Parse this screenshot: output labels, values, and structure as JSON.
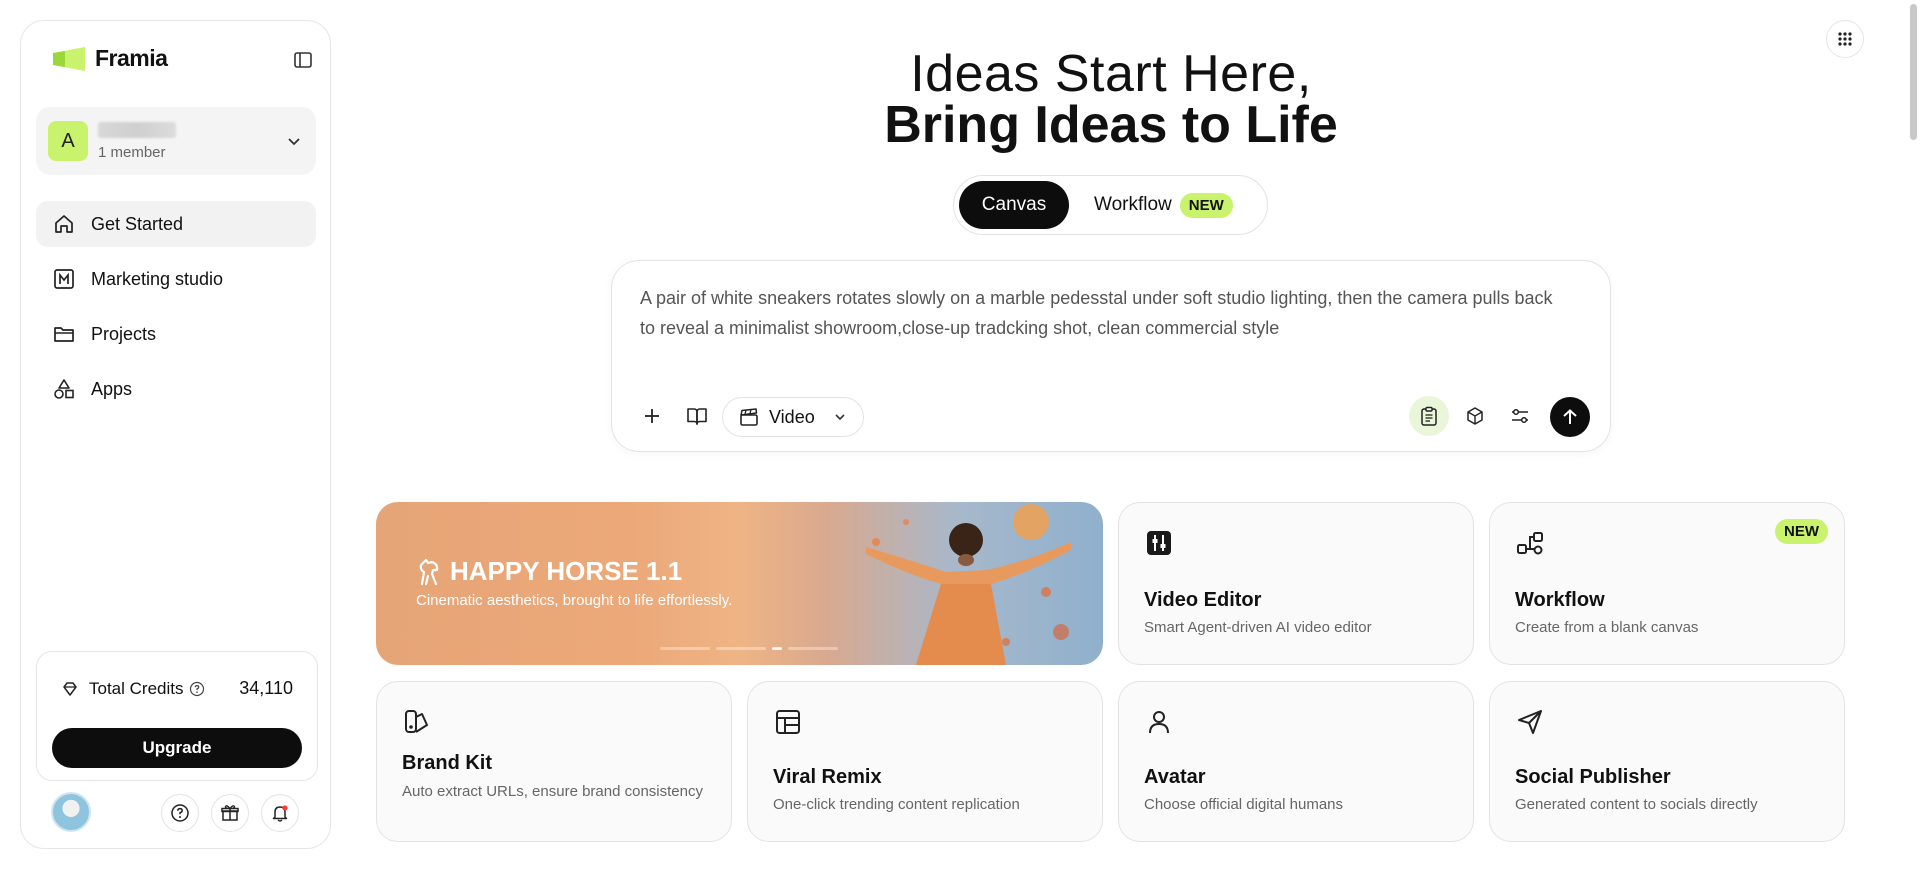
{
  "brand": {
    "name": "Framia",
    "accent": "#c9f26d"
  },
  "team": {
    "initial": "A",
    "members": "1 member"
  },
  "nav": [
    {
      "label": "Get Started",
      "icon": "home-icon",
      "active": true
    },
    {
      "label": "Marketing studio",
      "icon": "m-box-icon",
      "active": false
    },
    {
      "label": "Projects",
      "icon": "folder-icon",
      "active": false
    },
    {
      "label": "Apps",
      "icon": "shapes-icon",
      "active": false
    }
  ],
  "credits": {
    "label": "Total Credits",
    "value": "34,110",
    "upgrade_label": "Upgrade"
  },
  "hero": {
    "line1": "Ideas Start Here,",
    "line2": "Bring Ideas to Life"
  },
  "mode": {
    "canvas": "Canvas",
    "workflow": "Workflow",
    "badge": "NEW"
  },
  "prompt": {
    "text": "A pair of white sneakers rotates slowly on a marble pedesstal under soft studio lighting, then the camera pulls back to reveal a minimalist showroom,close-up tradcking shot, clean commercial style",
    "media_type": "Video"
  },
  "banner": {
    "title": "HAPPY HORSE 1.1",
    "subtitle": "Cinematic aesthetics, brought to life effortlessly."
  },
  "cards": {
    "video_editor": {
      "title": "Video Editor",
      "desc": "Smart Agent-driven AI video editor"
    },
    "workflow": {
      "title": "Workflow",
      "desc": "Create from a blank canvas",
      "badge": "NEW"
    },
    "brand_kit": {
      "title": "Brand Kit",
      "desc": "Auto extract URLs, ensure brand consistency"
    },
    "viral_remix": {
      "title": "Viral Remix",
      "desc": "One-click trending content replication"
    },
    "avatar": {
      "title": "Avatar",
      "desc": "Choose official digital humans"
    },
    "social_publisher": {
      "title": "Social Publisher",
      "desc": "Generated content to socials directly"
    }
  }
}
